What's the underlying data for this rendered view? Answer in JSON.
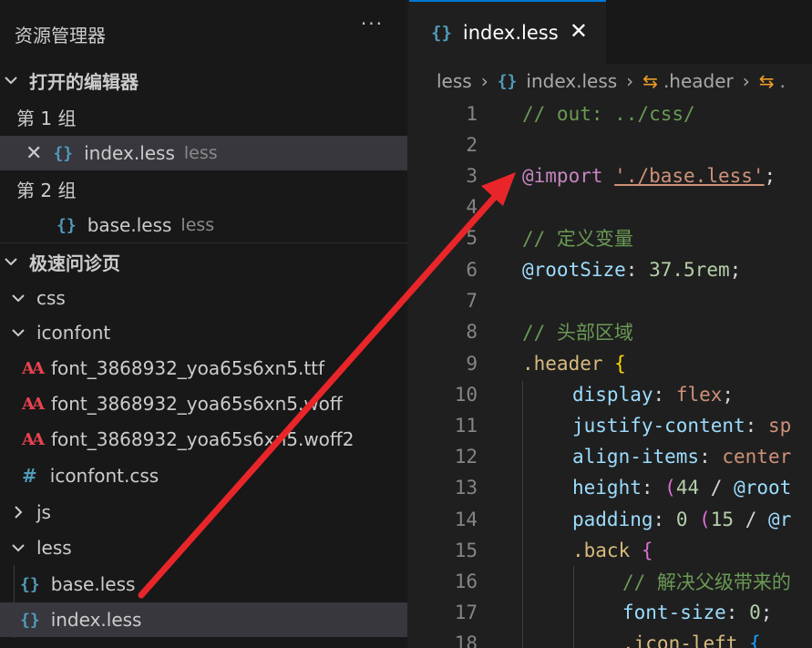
{
  "sidebar": {
    "title": "资源管理器",
    "more_label": "···",
    "open_editors": {
      "header": "打开的编辑器",
      "groups": [
        {
          "label": "第 1 组",
          "file": "index.less",
          "lang": "less"
        },
        {
          "label": "第 2 组",
          "file": "base.less",
          "lang": "less"
        }
      ]
    },
    "project": {
      "header": "极速问诊页",
      "items": [
        {
          "label": "css"
        },
        {
          "label": "iconfont"
        },
        {
          "label": "font_3868932_yoa65s6xn5.ttf"
        },
        {
          "label": "font_3868932_yoa65s6xn5.woff"
        },
        {
          "label": "font_3868932_yoa65s6xn5.woff2"
        },
        {
          "label": "iconfont.css"
        },
        {
          "label": "js"
        },
        {
          "label": "less"
        },
        {
          "label": "base.less"
        },
        {
          "label": "index.less"
        }
      ]
    }
  },
  "editor": {
    "tab": {
      "label": "index.less"
    },
    "breadcrumb": {
      "folder": "less",
      "file": "index.less",
      "symbol1": ".header",
      "symbol2": "."
    },
    "line_numbers": [
      "1",
      "2",
      "3",
      "4",
      "5",
      "6",
      "7",
      "8",
      "9",
      "10",
      "11",
      "12",
      "13",
      "14",
      "15",
      "16",
      "17",
      "18"
    ],
    "code": {
      "l1": "// out: ../css/",
      "l3_kw": "@import",
      "l3_str": "'./base.less'",
      "l3_semi": ";",
      "l5": "// 定义变量",
      "l6_var": "@rootSize",
      "l6_colon": ":",
      "l6_val": "37.5rem",
      "l6_semi": ";",
      "l8": "// 头部区域",
      "l9_sel": ".header",
      "l9_brace": "{",
      "l10_prop": "display",
      "l10_val": "flex",
      "l11_prop": "justify-content",
      "l11_val": "sp",
      "l12_prop": "align-items",
      "l12_val": "center",
      "l13_prop": "height",
      "l13_p": "(",
      "l13_num": "44",
      "l13_op": "/",
      "l13_var": "@root",
      "l14_prop": "padding",
      "l14_num0": "0",
      "l14_p": "(",
      "l14_num": "15",
      "l14_op": "/",
      "l14_var": "@r",
      "l15_sel": ".back",
      "l15_brace": "{",
      "l16": "// 解决父级带来的",
      "l17_prop": "font-size",
      "l17_num": "0",
      "l18_sel": ".icon-left",
      "l18_brace": "{"
    }
  },
  "colors": {
    "accent": "#0078d4",
    "annotation_arrow": "#e8262a"
  }
}
